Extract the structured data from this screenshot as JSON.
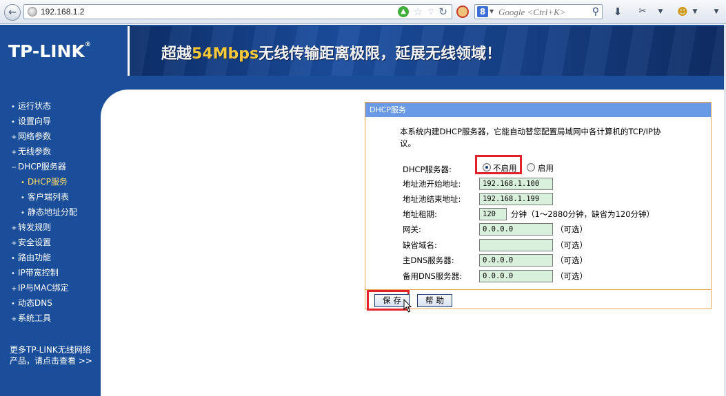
{
  "browser": {
    "url": "192.168.1.2",
    "search_placeholder": "Google <Ctrl+K>"
  },
  "header": {
    "logo": "TP-LINK",
    "logo_mark": "®",
    "slogan_pre": "超越",
    "slogan_strong": "54Mbps",
    "slogan_post": "无线传输距离极限，延展无线领域！"
  },
  "sidebar": {
    "items": [
      {
        "label": "运行状态",
        "bullet": "•"
      },
      {
        "label": "设置向导",
        "bullet": "•"
      },
      {
        "label": "网络参数",
        "bullet": "+"
      },
      {
        "label": "无线参数",
        "bullet": "+"
      },
      {
        "label": "DHCP服务器",
        "bullet": "−"
      },
      {
        "label": "DHCP服务",
        "bullet": "•"
      },
      {
        "label": "客户端列表",
        "bullet": "•"
      },
      {
        "label": "静态地址分配",
        "bullet": "•"
      },
      {
        "label": "转发规则",
        "bullet": "+"
      },
      {
        "label": "安全设置",
        "bullet": "+"
      },
      {
        "label": "路由功能",
        "bullet": "•"
      },
      {
        "label": "IP带宽控制",
        "bullet": "•"
      },
      {
        "label": "IP与MAC绑定",
        "bullet": "+"
      },
      {
        "label": "动态DNS",
        "bullet": "•"
      },
      {
        "label": "系统工具",
        "bullet": "+"
      }
    ],
    "more_line1": "更多TP-LINK无线网络",
    "more_line2": "产品，请点击查看 >>"
  },
  "dhcp": {
    "title": "DHCP服务",
    "description": "本系统内建DHCP服务器，它能自动替您配置局域网中各计算机的TCP/IP协议。",
    "server_label": "DHCP服务器:",
    "disable_label": "不启用",
    "enable_label": "启用",
    "selected": "不启用",
    "start_label": "地址池开始地址:",
    "start_value": "192.168.1.100",
    "end_label": "地址池结束地址:",
    "end_value": "192.168.1.199",
    "lease_label": "地址租期:",
    "lease_value": "120",
    "lease_hint": "分钟（1～2880分钟，缺省为120分钟）",
    "gateway_label": "网关:",
    "gateway_value": "0.0.0.0",
    "domain_label": "缺省域名:",
    "domain_value": "",
    "dns1_label": "主DNS服务器:",
    "dns1_value": "0.0.0.0",
    "dns2_label": "备用DNS服务器:",
    "dns2_value": "0.0.0.0",
    "optional": "（可选）",
    "save_label": "保存",
    "help_label": "帮助"
  },
  "colors": {
    "brand_blue": "#1a4e9a",
    "panel_title": "#6a9ae6",
    "panel_border": "#e9a64a",
    "field_bg": "#d9f0dc",
    "highlight": "#e2222a"
  }
}
